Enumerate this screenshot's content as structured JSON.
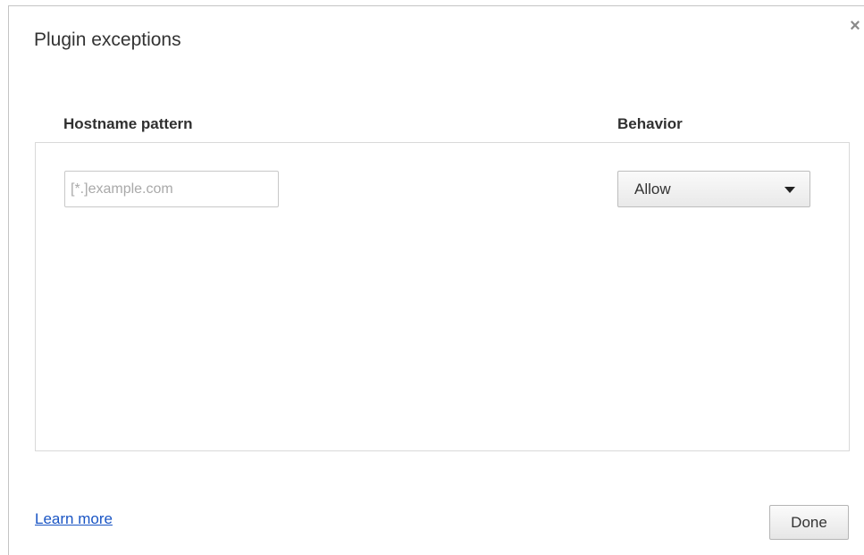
{
  "dialog": {
    "title": "Plugin exceptions",
    "close_symbol": "×"
  },
  "columns": {
    "hostname_header": "Hostname pattern",
    "behavior_header": "Behavior"
  },
  "new_entry": {
    "hostname_value": "",
    "hostname_placeholder": "[*.]example.com",
    "behavior_selected": "Allow"
  },
  "footer": {
    "learn_more_label": "Learn more",
    "done_label": "Done"
  },
  "colors": {
    "link": "#1a55c4",
    "border": "#d9d9d9"
  },
  "icons": {
    "close": "close-icon",
    "dropdown": "chevron-down-icon"
  }
}
